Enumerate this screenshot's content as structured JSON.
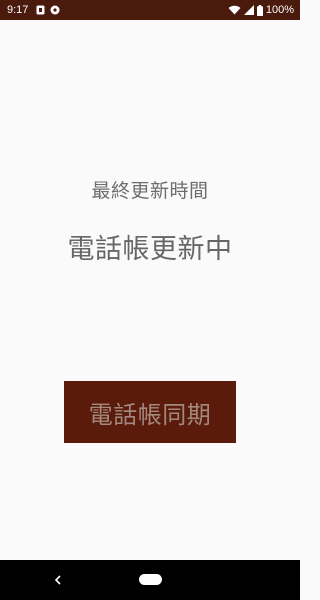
{
  "colors": {
    "status_bar": "#4a1a0c",
    "button_bg": "#5b1b0b",
    "button_text": "#a38880",
    "body_bg": "#fafafa",
    "text_gray": "#6d6d6d",
    "nav_bar": "#000000"
  },
  "status_bar": {
    "time": "9:17",
    "left_icons": [
      "sim-icon",
      "settings-icon"
    ],
    "right_icons": [
      "wifi-icon",
      "signal-icon",
      "battery-icon"
    ],
    "battery_text": "100%"
  },
  "main": {
    "last_update_label": "最終更新時間",
    "update_status": "電話帳更新中",
    "sync_button_label": "電話帳同期"
  },
  "nav_bar": {
    "icons": [
      "back-icon",
      "home-icon"
    ]
  }
}
